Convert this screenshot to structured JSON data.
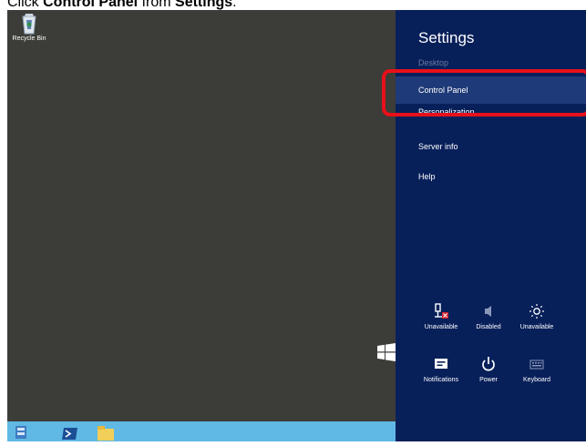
{
  "instruction": {
    "prefix": "Click ",
    "target": "Control Panel",
    "middle": " from ",
    "source": "Settings",
    "suffix": "."
  },
  "desktop": {
    "recycle_bin_label": "Recycle Bin"
  },
  "taskbar": {
    "icons": [
      "server-manager-icon",
      "powershell-icon",
      "file-explorer-icon"
    ]
  },
  "charms": {
    "title": "Settings",
    "context_label": "Desktop",
    "items": [
      {
        "label": "Control Panel",
        "selected": true
      },
      {
        "label": "Personalization",
        "selected": false
      },
      {
        "label": "Server info",
        "selected": false
      },
      {
        "label": "Help",
        "selected": false
      }
    ],
    "quick_settings": [
      {
        "icon": "network-icon",
        "label": "Unavailable"
      },
      {
        "icon": "volume-icon",
        "label": "Disabled"
      },
      {
        "icon": "brightness-icon",
        "label": "Unavailable"
      },
      {
        "icon": "notifications-icon",
        "label": "Notifications"
      },
      {
        "icon": "power-icon",
        "label": "Power"
      },
      {
        "icon": "keyboard-icon",
        "label": "Keyboard"
      }
    ]
  },
  "colors": {
    "charms_background": "#08205a",
    "selected_item": "#1e3a78",
    "highlight_border": "#e8101a",
    "desktop_background": "#3c3c38",
    "taskbar": "#5fb9e4"
  }
}
